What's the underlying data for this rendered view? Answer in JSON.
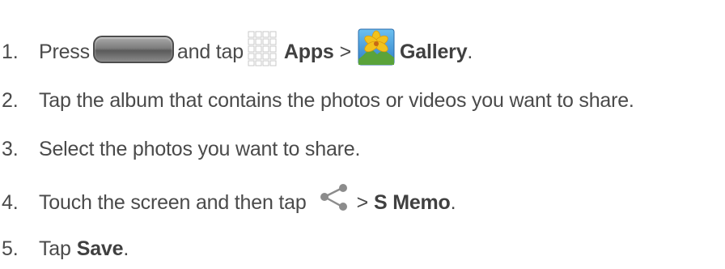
{
  "steps": [
    {
      "number": "1.",
      "parts": {
        "a": "Press",
        "b": "and tap",
        "c": "Apps",
        "d": ">",
        "e": "Gallery",
        "f": "."
      }
    },
    {
      "number": "2.",
      "text": "Tap the album that contains the photos or videos you want to share."
    },
    {
      "number": "3.",
      "text": "Select the photos you want to share."
    },
    {
      "number": "4.",
      "parts": {
        "a": "Touch the screen and then tap",
        "b": ">",
        "c": "S Memo",
        "d": "."
      }
    },
    {
      "number": "5.",
      "parts": {
        "a": "Tap",
        "b": "Save",
        "c": "."
      }
    }
  ],
  "icons": {
    "home_key": "home-key-icon",
    "apps": "apps-grid-icon",
    "gallery": "gallery-icon",
    "share": "share-icon"
  },
  "colors": {
    "text": "#4a4a4a",
    "bold_text": "#404040",
    "apps_grid": "#cfcfcf",
    "gallery_sky": "#3a8fd6",
    "gallery_flower": "#f2c21b",
    "share_icon": "#8a8a8a"
  }
}
